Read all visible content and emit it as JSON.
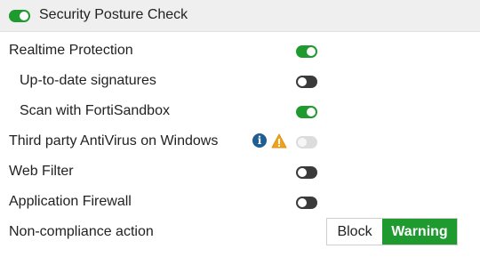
{
  "header": {
    "title": "Security Posture Check",
    "enabled": true
  },
  "rows": [
    {
      "label": "Realtime Protection",
      "toggle": "on"
    },
    {
      "label": "Up-to-date signatures",
      "toggle": "off"
    },
    {
      "label": "Scan with FortiSandbox",
      "toggle": "on"
    },
    {
      "label": "Third party AntiVirus on Windows",
      "toggle": "disabled",
      "icons": [
        "info-icon",
        "warning-icon"
      ]
    },
    {
      "label": "Web Filter",
      "toggle": "off"
    },
    {
      "label": "Application Firewall",
      "toggle": "off"
    },
    {
      "label": "Non-compliance action"
    }
  ],
  "noncompliance": {
    "options": [
      "Block",
      "Warning"
    ],
    "selected": "Warning"
  },
  "colors": {
    "accent_green": "#1e9a2f",
    "toggle_off": "#3a3a3a",
    "info_blue": "#1f5e92",
    "warning_orange": "#f0a21a"
  }
}
